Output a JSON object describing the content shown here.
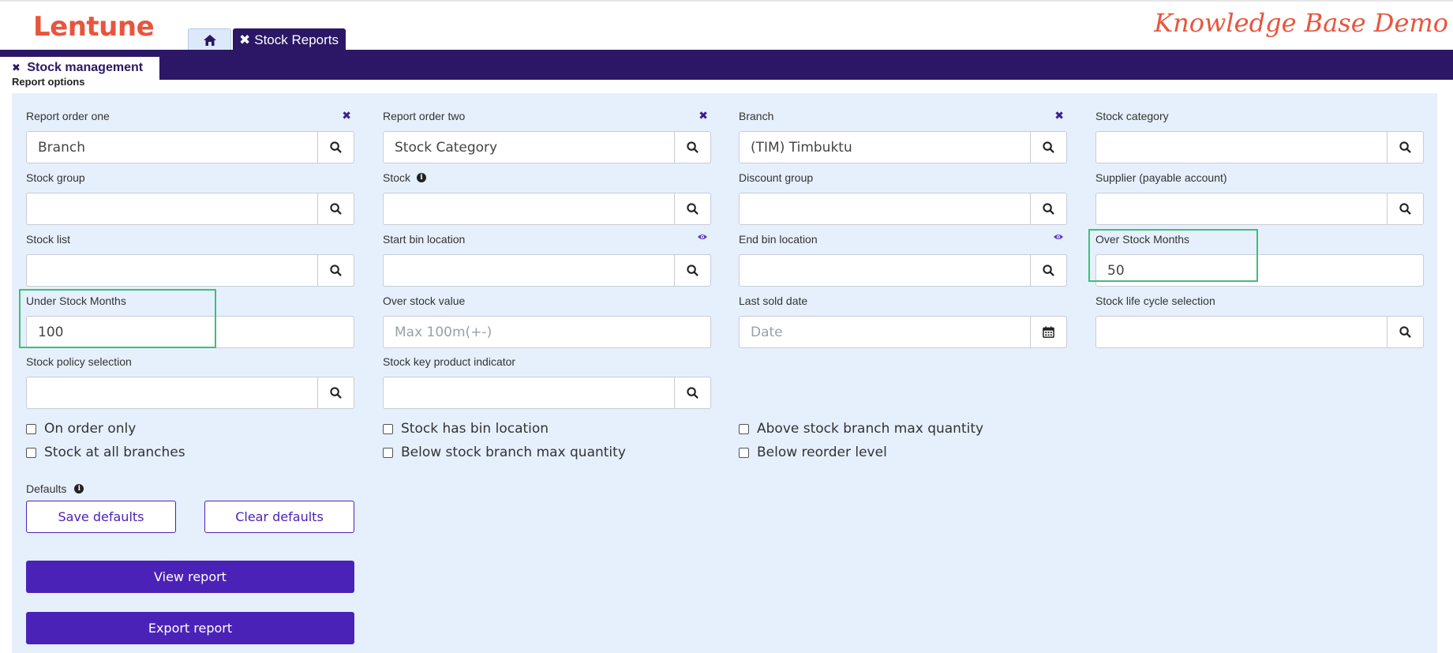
{
  "header": {
    "logo": "Lentune",
    "banner": "Knowledge Base Demo",
    "home_tab_icon": "home-icon",
    "active_tab_label": "Stock Reports",
    "close_glyph": "✖"
  },
  "subnav": {
    "tab_label": "Stock management",
    "close_glyph": "✖",
    "section_label": "Report options"
  },
  "fields": {
    "report_order_one": {
      "label": "Report order one",
      "value": "Branch"
    },
    "report_order_two": {
      "label": "Report order two",
      "value": "Stock Category"
    },
    "branch": {
      "label": "Branch",
      "value": "(TIM) Timbuktu"
    },
    "stock_category": {
      "label": "Stock category",
      "value": ""
    },
    "stock_group": {
      "label": "Stock group",
      "value": ""
    },
    "stock": {
      "label": "Stock",
      "value": ""
    },
    "discount_group": {
      "label": "Discount group",
      "value": ""
    },
    "supplier": {
      "label": "Supplier (payable account)",
      "value": ""
    },
    "stock_list": {
      "label": "Stock list",
      "value": ""
    },
    "start_bin": {
      "label": "Start bin location",
      "value": ""
    },
    "end_bin": {
      "label": "End bin location",
      "value": ""
    },
    "over_stock_months": {
      "label": "Over Stock Months",
      "value": "50"
    },
    "under_stock_months": {
      "label": "Under Stock Months",
      "value": "100"
    },
    "over_stock_value": {
      "label": "Over stock value",
      "placeholder": "Max 100m(+-)"
    },
    "last_sold_date": {
      "label": "Last sold date",
      "placeholder": "Date"
    },
    "stock_life_cycle": {
      "label": "Stock life cycle selection",
      "value": ""
    },
    "stock_policy": {
      "label": "Stock policy selection",
      "value": ""
    },
    "stock_key_product": {
      "label": "Stock key product indicator",
      "value": ""
    },
    "clear_glyph": "✖"
  },
  "checkboxes": {
    "on_order_only": {
      "label": "On order only",
      "checked": false
    },
    "stock_all_branches": {
      "label": "Stock at all branches",
      "checked": false
    },
    "has_bin_location": {
      "label": "Stock has bin location",
      "checked": false
    },
    "below_branch_max": {
      "label": "Below stock branch max quantity",
      "checked": false
    },
    "above_branch_max": {
      "label": "Above stock branch max quantity",
      "checked": false
    },
    "below_reorder": {
      "label": "Below reorder level",
      "checked": false
    }
  },
  "defaults": {
    "label": "Defaults",
    "save_label": "Save defaults",
    "clear_label": "Clear defaults"
  },
  "actions": {
    "view_label": "View report",
    "export_label": "Export report"
  },
  "colors": {
    "brand": "#e8553d",
    "nav": "#2b1766",
    "primary": "#4b22b8",
    "panel": "#e6f0fc",
    "highlight": "#3cc07a"
  }
}
